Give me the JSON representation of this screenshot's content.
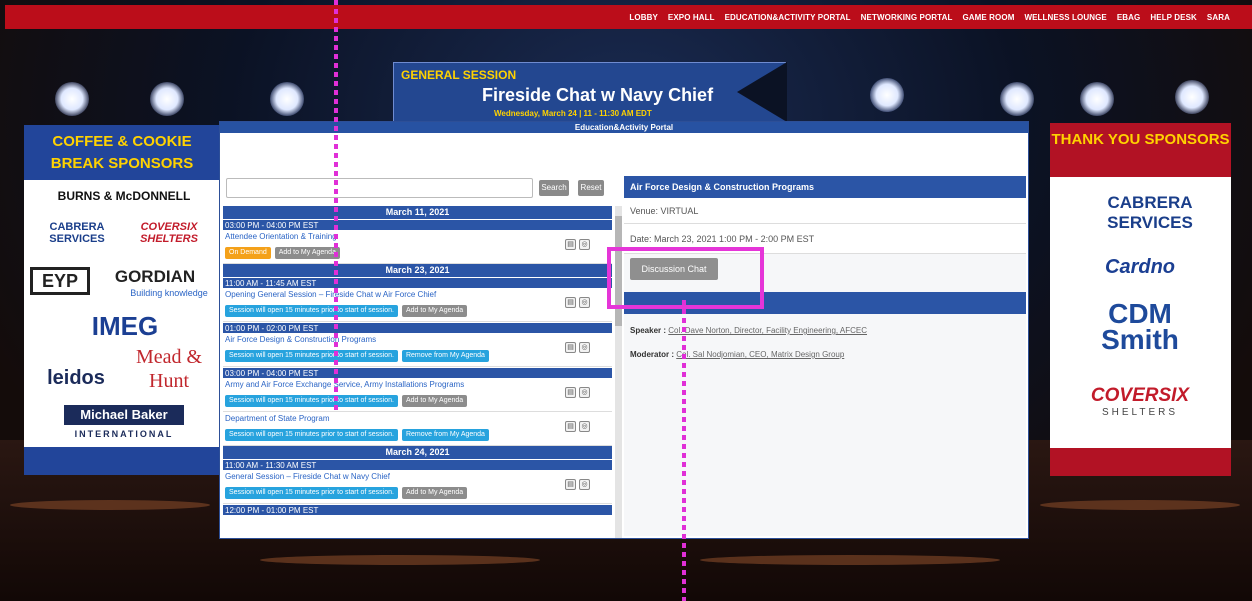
{
  "nav": {
    "items": [
      "LOBBY",
      "EXPO HALL",
      "EDUCATION&ACTIVITY PORTAL",
      "NETWORKING PORTAL",
      "GAME ROOM",
      "WELLNESS LOUNGE",
      "EBAG",
      "HELP DESK",
      "SARA"
    ]
  },
  "banner": {
    "label": "GENERAL SESSION",
    "title": "Fireside Chat w Navy Chief",
    "subtitle": "Wednesday, March 24 | 11 - 11:30 AM EDT"
  },
  "left_sponsors": {
    "heading": "COFFEE & COOKIE BREAK SPONSORS",
    "logos": [
      "BURNS & McDONNELL",
      "CABRERA SERVICES",
      "COVERSIX SHELTERS",
      "EYP",
      "GORDIAN",
      "Building knowledge",
      "IMEG",
      "leidos",
      "Mead & Hunt",
      "Michael Baker",
      "INTERNATIONAL"
    ]
  },
  "right_sponsors": {
    "heading": "THANK YOU SPONSORS",
    "logos": [
      "CABRERA SERVICES",
      "Cardno",
      "CDM Smith",
      "COVERSIX",
      "SHELTERS"
    ]
  },
  "portal": {
    "title": "Education&Activity Portal",
    "search_button": "Search",
    "reset_button": "Reset",
    "days": [
      {
        "date": "March 11, 2021",
        "slots": [
          {
            "time": "03:00 PM - 04:00 PM EST",
            "sessions": [
              {
                "title": "Attendee Orientation & Training",
                "tags": [
                  {
                    "label": "On Demand",
                    "color": "orange"
                  },
                  {
                    "label": "Add to My Agenda",
                    "color": "grey"
                  }
                ]
              }
            ]
          }
        ]
      },
      {
        "date": "March 23, 2021",
        "slots": [
          {
            "time": "11:00 AM - 11:45 AM EST",
            "sessions": [
              {
                "title": "Opening General Session – Fireside Chat w Air Force Chief",
                "tags": [
                  {
                    "label": "Session will open 15 minutes prior to start of session.",
                    "color": "cyan"
                  },
                  {
                    "label": "Add to My Agenda",
                    "color": "grey"
                  }
                ]
              }
            ]
          },
          {
            "time": "01:00 PM - 02:00 PM EST",
            "sessions": [
              {
                "title": "Air Force Design & Construction Programs",
                "tags": [
                  {
                    "label": "Session will open 15 minutes prior to start of session.",
                    "color": "cyan"
                  },
                  {
                    "label": "Remove from My Agenda",
                    "color": "cyan"
                  }
                ]
              }
            ]
          },
          {
            "time": "03:00 PM - 04:00 PM EST",
            "sessions": [
              {
                "title": "Army and Air Force Exchange Service, Army Installations Programs",
                "tags": [
                  {
                    "label": "Session will open 15 minutes prior to start of session.",
                    "color": "cyan"
                  },
                  {
                    "label": "Add to My Agenda",
                    "color": "grey"
                  }
                ]
              },
              {
                "title": "Department of State Program",
                "tags": [
                  {
                    "label": "Session will open 15 minutes prior to start of session.",
                    "color": "cyan"
                  },
                  {
                    "label": "Remove from My Agenda",
                    "color": "cyan"
                  }
                ]
              }
            ]
          }
        ]
      },
      {
        "date": "March 24, 2021",
        "slots": [
          {
            "time": "11:00 AM - 11:30 AM EST",
            "sessions": [
              {
                "title": "General Session – Fireside Chat w Navy Chief",
                "tags": [
                  {
                    "label": "Session will open 15 minutes prior to start of session.",
                    "color": "cyan"
                  },
                  {
                    "label": "Add to My Agenda",
                    "color": "grey"
                  }
                ]
              }
            ]
          },
          {
            "time": "12:00 PM - 01:00 PM EST",
            "sessions": []
          }
        ]
      }
    ],
    "detail": {
      "title": "Air Force Design & Construction Programs",
      "venue": "Venue: VIRTUAL",
      "date": "Date: March 23, 2021 1:00 PM - 2:00 PM EST",
      "chat_button": "Discussion Chat",
      "speaker_label": "Speaker :",
      "speaker": "Col. Dave Norton, Director, Facility Engineering, AFCEC",
      "moderator_label": "Moderator :",
      "moderator": "Col. Sal Nodjomian, CEO, Matrix Design Group"
    }
  },
  "colors": {
    "nav_red": "#bb0d1a",
    "portal_blue": "#2b55a6",
    "annotation": "#e535d8"
  }
}
